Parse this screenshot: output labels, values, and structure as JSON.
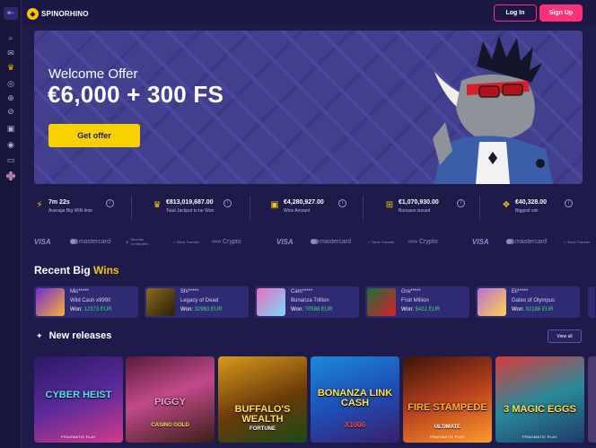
{
  "header": {
    "logo": "SPINORHINO",
    "login_label": "Log In",
    "signup_label": "Sign Up"
  },
  "sidebar": {
    "icons": [
      "collapse-icon",
      "search-icon",
      "promotions-icon",
      "crown-icon",
      "casino-icon",
      "live-casino-icon",
      "sports-icon",
      "games-icon",
      "support-icon",
      "chat-icon",
      "flag-uk-icon"
    ]
  },
  "hero": {
    "title": "Welcome Offer",
    "amount": "€6,000 + 300 FS",
    "cta": "Get offer"
  },
  "stats": [
    {
      "value": "7m 22s",
      "label": "Average Big WIN time",
      "icon": "lightning-icon"
    },
    {
      "value": "€813,019,687.00",
      "label": "Total Jackpot to be Won",
      "icon": "crown-icon"
    },
    {
      "value": "€4,280,927.00",
      "label": "Wins Amount",
      "icon": "wallet-icon"
    },
    {
      "value": "€1,070,930.00",
      "label": "Bonuses issued",
      "icon": "gift-icon"
    },
    {
      "value": "€40,328.00",
      "label": "Biggest win",
      "icon": "trophy-icon"
    }
  ],
  "payments": [
    "VISA",
    "mastercard",
    "Security Certificates",
    "Bank Transfer",
    "Crypto",
    "VISA",
    "mastercard",
    "Bank Transfer",
    "Crypto",
    "VISA",
    "mastercard",
    "Bank Transfer"
  ],
  "big_wins": {
    "title_start": "Recent Big",
    "title_highlight": "Wins",
    "won_label": "Won:",
    "items": [
      {
        "user": "Mic*****",
        "game": "Wild Cash x9990",
        "amount": "12373 EUR",
        "color": "#6f2bd8"
      },
      {
        "user": "Shi*****",
        "game": "Legacy of Dead",
        "amount": "32963 EUR",
        "color": "#8a6a1c"
      },
      {
        "user": "Cam*****",
        "game": "Bonanza Trillion",
        "amount": "70588 EUR",
        "color": "#e86fb8"
      },
      {
        "user": "Gra*****",
        "game": "Fruit Million",
        "amount": "5422 EUR",
        "color": "#1f6e3a"
      },
      {
        "user": "Eli*****",
        "game": "Gates of Olympus",
        "amount": "92188 EUR",
        "color": "#b86fd8"
      }
    ]
  },
  "releases": {
    "title": "New releases",
    "view_all": "View all",
    "games": [
      {
        "title": "CYBER HEIST",
        "subtitle": "",
        "provider": "PRAGMATIC PLAY",
        "color": "#5a2a9a"
      },
      {
        "title": "PIGGY",
        "subtitle": "CASINO GOLD",
        "provider": "",
        "color": "#9a2a5a"
      },
      {
        "title": "BUFFALO'S WEALTH",
        "subtitle": "FORTUNE",
        "provider": "",
        "color": "#a86a10"
      },
      {
        "title": "BONANZA LINK CASH",
        "subtitle": "X1000",
        "provider": "",
        "color": "#1e4fb8"
      },
      {
        "title": "FIRE STAMPEDE",
        "subtitle": "ULTIMATE",
        "provider": "PRAGMATIC PLAY",
        "color": "#b8401e"
      },
      {
        "title": "3 MAGIC EGGS",
        "subtitle": "",
        "provider": "PRAGMATIC PLAY",
        "color": "#2a8a9a"
      }
    ]
  }
}
